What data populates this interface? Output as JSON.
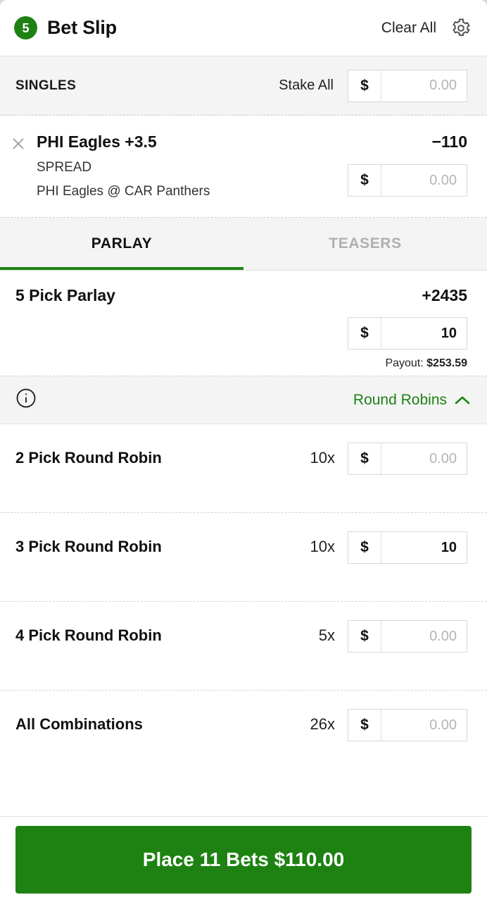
{
  "header": {
    "badge_count": "5",
    "title": "Bet Slip",
    "clear_all_label": "Clear All",
    "settings_icon": "gear-icon",
    "badge_color": "#1e8213"
  },
  "singles_section": {
    "label": "SINGLES",
    "stake_all_label": "Stake All",
    "stake_all_currency": "$",
    "stake_all_value": "",
    "stake_all_placeholder": "0.00"
  },
  "single_bets": [
    {
      "remove_icon": "close-icon",
      "selection": "PHI Eagles +3.5",
      "odds": "−110",
      "market": "SPREAD",
      "event": "PHI Eagles @ CAR Panthers",
      "stake_currency": "$",
      "stake_value": "",
      "stake_placeholder": "0.00"
    }
  ],
  "tabs": [
    {
      "label": "PARLAY",
      "active": true
    },
    {
      "label": "TEASERS",
      "active": false
    }
  ],
  "parlay": {
    "name": "5 Pick Parlay",
    "odds": "+2435",
    "stake_currency": "$",
    "stake_value": "10",
    "stake_placeholder": "0.00",
    "payout_label": "Payout:",
    "payout_value": "$253.59"
  },
  "round_robins": {
    "info_icon": "info-icon",
    "toggle_label": "Round Robins",
    "toggle_icon": "chevron-up-icon",
    "toggle_color": "#1e8213",
    "expanded": true,
    "rows": [
      {
        "name": "2 Pick Round Robin",
        "multiplier": "10x",
        "stake_currency": "$",
        "stake_value": "",
        "stake_placeholder": "0.00"
      },
      {
        "name": "3 Pick Round Robin",
        "multiplier": "10x",
        "stake_currency": "$",
        "stake_value": "10",
        "stake_placeholder": "0.00"
      },
      {
        "name": "4 Pick Round Robin",
        "multiplier": "5x",
        "stake_currency": "$",
        "stake_value": "",
        "stake_placeholder": "0.00"
      },
      {
        "name": "All Combinations",
        "multiplier": "26x",
        "stake_currency": "$",
        "stake_value": "",
        "stake_placeholder": "0.00"
      }
    ]
  },
  "footer": {
    "place_bets_label": "Place 11 Bets $110.00",
    "button_color": "#1e8213"
  }
}
